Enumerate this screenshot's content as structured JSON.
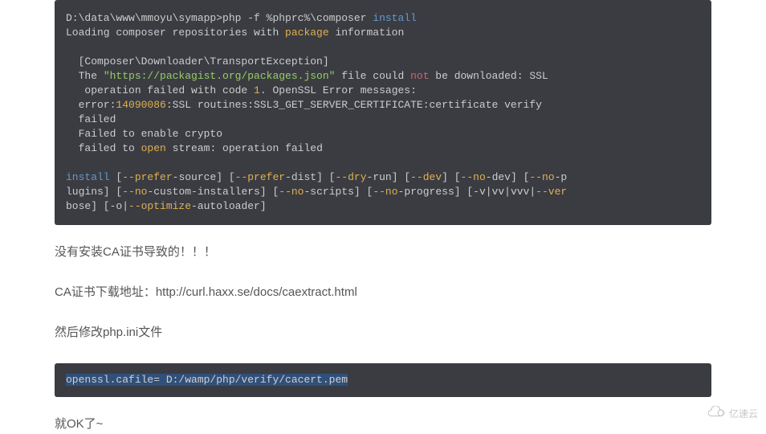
{
  "code1": {
    "line1a": "D:\\data\\www\\mmoyu\\symapp>php -f %phprc%\\composer ",
    "line1b": "install",
    "line2a": "Loading composer repositories with ",
    "line2b": "package",
    "line2c": " information",
    "gap1": "",
    "line3": "  [Composer\\Downloader\\TransportException]",
    "line4a": "  The ",
    "line4b": "\"https://packagist.org/packages.json\"",
    "line4c": " file could ",
    "line4d": "not",
    "line4e": " be downloaded: SSL",
    "line5a": "   operation failed with code ",
    "line5b": "1",
    "line5c": ". OpenSSL ",
    "line5d": "Error",
    "line5e": " messages:",
    "line6a": "  error:",
    "line6b": "14090086",
    "line6c": ":SSL routines:SSL3_GET_SERVER_CERTIFICATE:certificate verify",
    "line7": "  failed",
    "line8": "  Failed to enable crypto",
    "line9a": "  failed to ",
    "line9b": "open",
    "line9c": " stream: operation failed",
    "gap2": "",
    "line10a": "install",
    "line10b": " [",
    "line10c": "--prefer",
    "line10d": "-source] [",
    "line10e": "--prefer",
    "line10f": "-dist] [",
    "line10g": "--dry",
    "line10h": "-run] [",
    "line10i": "--dev",
    "line10j": "] [",
    "line10k": "--no",
    "line10l": "-dev] [",
    "line10m": "--no",
    "line10n": "-p",
    "line11a": "lugins] [",
    "line11b": "--no",
    "line11c": "-custom-installers] [",
    "line11d": "--no",
    "line11e": "-scripts] [",
    "line11f": "--no",
    "line11g": "-progress] [-v|vv|vvv|",
    "line11h": "--ver",
    "line12a": "bose] [-o|",
    "line12b": "--optimize",
    "line12c": "-autoloader]"
  },
  "paragraph1": "没有安装CA证书导致的！！！",
  "paragraph2": "CA证书下载地址：http://curl.haxx.se/docs/caextract.html",
  "paragraph3": "然后修改php.ini文件",
  "code2": "openssl.cafile= D:/wamp/php/verify/cacert.pem",
  "paragraph4": "就OK了~",
  "watermark": "亿速云"
}
